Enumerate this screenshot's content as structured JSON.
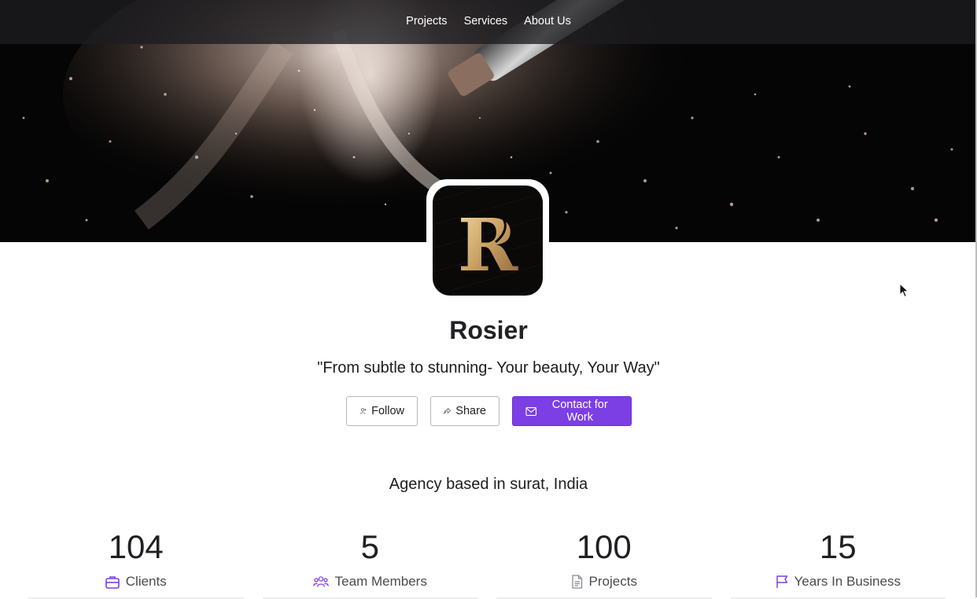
{
  "nav": {
    "items": [
      {
        "label": "Projects"
      },
      {
        "label": "Services"
      },
      {
        "label": "About Us"
      }
    ]
  },
  "hero": {
    "image": "makeup-brush-powder-burst",
    "logo_letter": "R"
  },
  "profile": {
    "name": "Rosier",
    "tagline": "\"From subtle to stunning- Your beauty, Your Way\""
  },
  "actions": {
    "follow_label": "Follow",
    "follow_icon": "user-plus-icon",
    "share_label": "Share",
    "share_icon": "share-arrow-icon",
    "contact_label": "Contact for Work",
    "contact_icon": "mail-icon",
    "accent": "#7b3fe4"
  },
  "about": {
    "location_text": "Agency based in surat, India"
  },
  "stats": [
    {
      "value": "104",
      "label": "Clients",
      "icon": "briefcase-icon"
    },
    {
      "value": "5",
      "label": "Team Members",
      "icon": "users-icon"
    },
    {
      "value": "100",
      "label": "Projects",
      "icon": "document-icon"
    },
    {
      "value": "15",
      "label": "Years In Business",
      "icon": "flag-icon"
    }
  ]
}
